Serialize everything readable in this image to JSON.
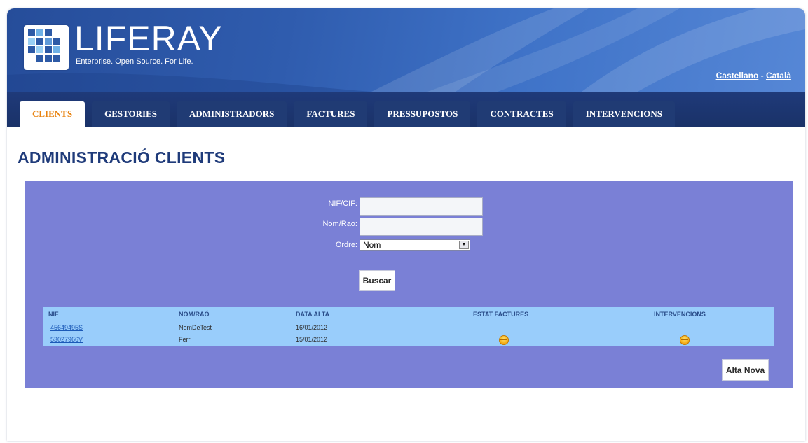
{
  "header": {
    "logo_text": "LIFERAY",
    "logo_tagline": "Enterprise. Open Source. For Life.",
    "lang_links": [
      "Castellano",
      "Català"
    ],
    "lang_separator": " - "
  },
  "nav": {
    "tabs": [
      {
        "label": "CLIENTS",
        "active": true
      },
      {
        "label": "GESTORIES",
        "active": false
      },
      {
        "label": "ADMINISTRADORS",
        "active": false
      },
      {
        "label": "FACTURES",
        "active": false
      },
      {
        "label": "PRESSUPOSTOS",
        "active": false
      },
      {
        "label": "CONTRACTES",
        "active": false
      },
      {
        "label": "INTERVENCIONS",
        "active": false
      }
    ]
  },
  "page": {
    "title": "ADMINISTRACIÓ CLIENTS"
  },
  "search": {
    "nif_label": "NIF/CIF:",
    "nif_value": "",
    "nom_label": "Nom/Rao:",
    "nom_value": "",
    "order_label": "Ordre:",
    "order_value": "Nom",
    "search_button": "Buscar"
  },
  "table": {
    "headers": [
      "NIF",
      "NOM/RAÓ",
      "DATA ALTA",
      "ESTAT FACTURES",
      "INTERVENCIONS"
    ],
    "rows": [
      {
        "nif": "45649495S",
        "nom": "NomDeTest",
        "data": "16/01/2012",
        "factures_icon": "",
        "intervencions_icon": ""
      },
      {
        "nif": "53027966V",
        "nom": "Ferri",
        "data": "15/01/2012",
        "factures_icon": "status-circle-icon",
        "intervencions_icon": "status-circle-icon"
      }
    ]
  },
  "new_button": "Alta Nova",
  "colors": {
    "banner": "#2f5cae",
    "navbar": "#1f3a7a",
    "active_tab_text": "#e8820e",
    "title": "#1f3b7a",
    "panel": "#7a80d6",
    "table_bg": "#99cdfb",
    "link": "#1b59b7"
  }
}
